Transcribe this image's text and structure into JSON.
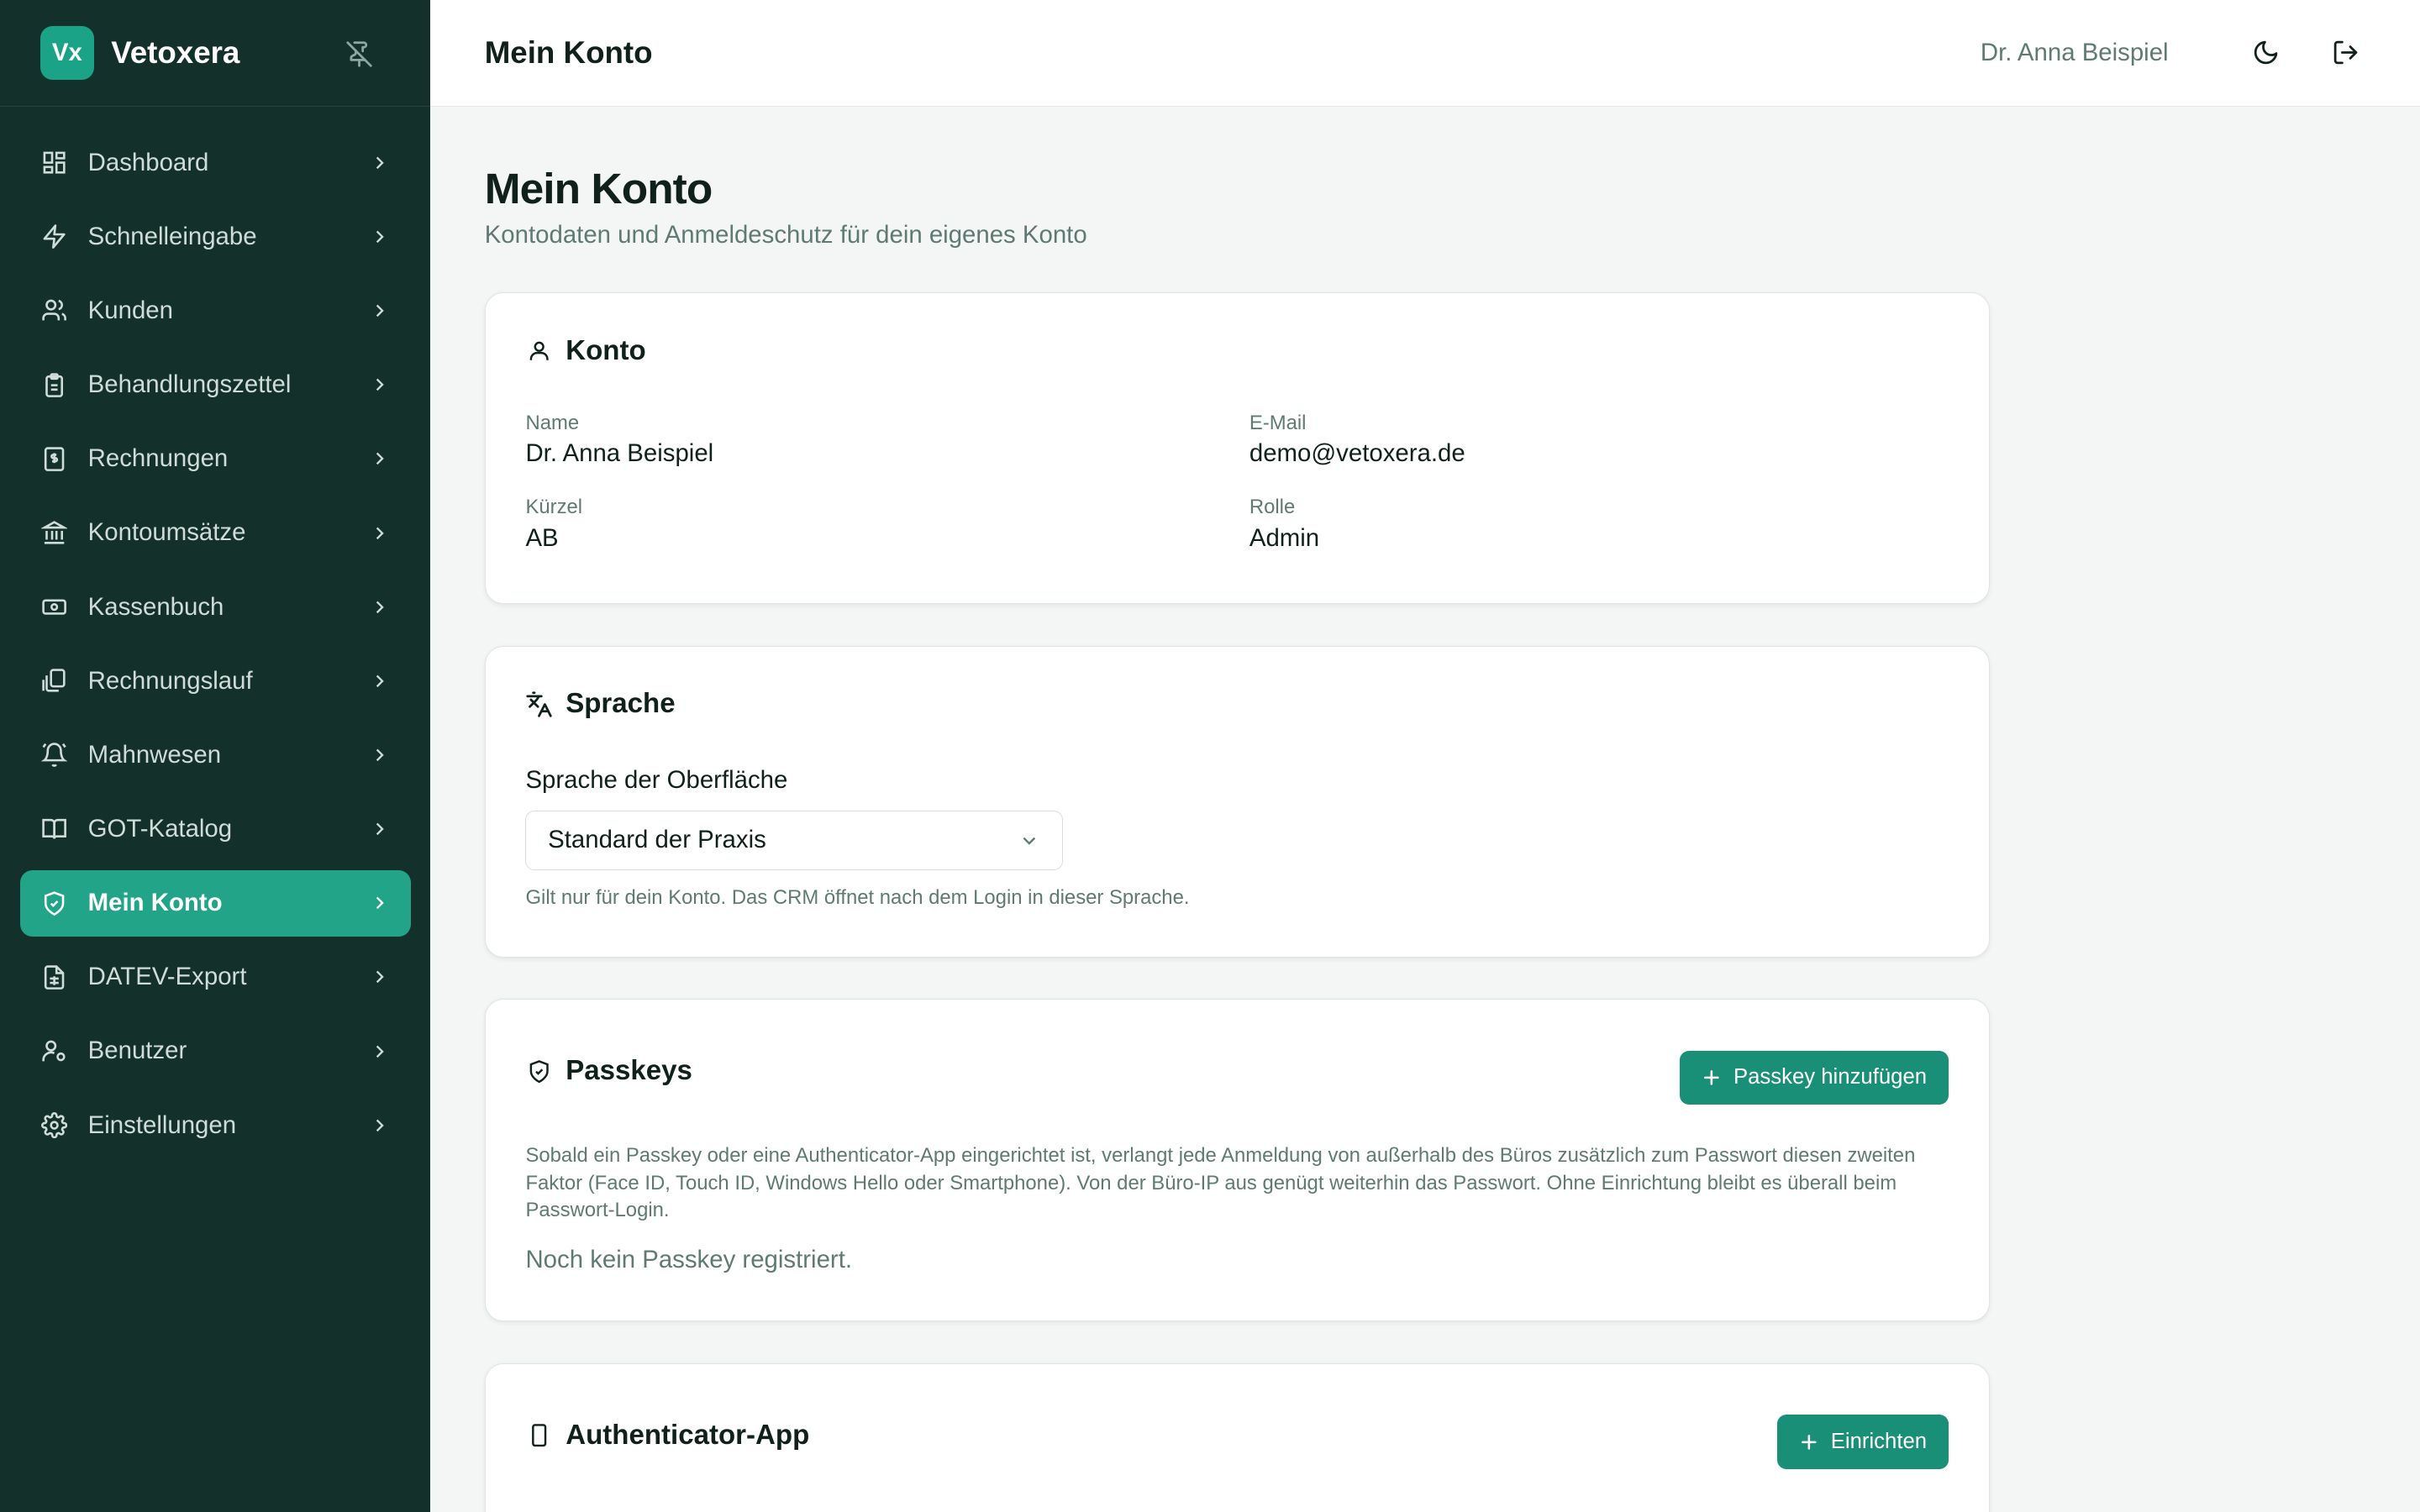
{
  "brand": {
    "logo": "Vx",
    "name": "Vetoxera"
  },
  "sidebar": {
    "items": [
      {
        "label": "Dashboard",
        "icon": "dashboard-icon"
      },
      {
        "label": "Schnelleingabe",
        "icon": "lightning-icon"
      },
      {
        "label": "Kunden",
        "icon": "users-icon"
      },
      {
        "label": "Behandlungszettel",
        "icon": "clipboard-icon"
      },
      {
        "label": "Rechnungen",
        "icon": "invoice-icon"
      },
      {
        "label": "Kontoumsätze",
        "icon": "bank-icon"
      },
      {
        "label": "Kassenbuch",
        "icon": "cash-icon"
      },
      {
        "label": "Rechnungslauf",
        "icon": "copy-stack-icon"
      },
      {
        "label": "Mahnwesen",
        "icon": "bell-icon"
      },
      {
        "label": "GOT-Katalog",
        "icon": "book-icon"
      },
      {
        "label": "Mein Konto",
        "icon": "shield-icon",
        "active": true
      },
      {
        "label": "DATEV-Export",
        "icon": "spreadsheet-icon"
      },
      {
        "label": "Benutzer",
        "icon": "user-gear-icon"
      },
      {
        "label": "Einstellungen",
        "icon": "gear-icon"
      }
    ]
  },
  "topbar": {
    "title": "Mein Konto",
    "user": "Dr. Anna Beispiel"
  },
  "page": {
    "title": "Mein Konto",
    "subtitle": "Kontodaten und Anmeldeschutz für dein eigenes Konto"
  },
  "account": {
    "title": "Konto",
    "name_label": "Name",
    "name": "Dr. Anna Beispiel",
    "email_label": "E-Mail",
    "email": "demo@vetoxera.de",
    "short_label": "Kürzel",
    "short": "AB",
    "role_label": "Rolle",
    "role": "Admin"
  },
  "language": {
    "title": "Sprache",
    "label": "Sprache der Oberfläche",
    "selected": "Standard der Praxis",
    "hint": "Gilt nur für dein Konto. Das CRM öffnet nach dem Login in dieser Sprache."
  },
  "passkeys": {
    "title": "Passkeys",
    "button": "Passkey hinzufügen",
    "description": "Sobald ein Passkey oder eine Authenticator-App eingerichtet ist, verlangt jede Anmeldung von außerhalb des Büros zusätzlich zum Passwort diesen zweiten Faktor (Face ID, Touch ID, Windows Hello oder Smartphone). Von der Büro-IP aus genügt weiterhin das Passwort. Ohne Einrichtung bleibt es überall beim Passwort-Login.",
    "empty": "Noch kein Passkey registriert."
  },
  "authenticator": {
    "title": "Authenticator-App",
    "button": "Einrichten"
  },
  "colors": {
    "sidebar": "#13312a",
    "accent": "#21a488",
    "button": "#1a8f77"
  }
}
